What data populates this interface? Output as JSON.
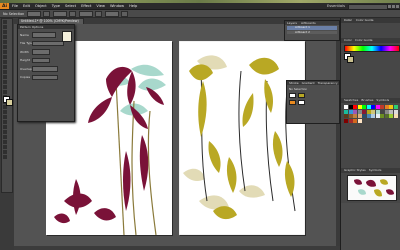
{
  "app": {
    "logo": "Ai",
    "menu": [
      "File",
      "Edit",
      "Object",
      "Type",
      "Select",
      "Effect",
      "View",
      "Window",
      "Help"
    ],
    "workspace": "Essentials",
    "icons": [
      "search-icon",
      "minimize-icon",
      "maximize-icon",
      "close-icon"
    ]
  },
  "control_bar": {
    "label": "No Selection"
  },
  "document": {
    "tab_title": "Untitled-1* @ 100% (CMYK/Preview)"
  },
  "float_panel": {
    "title": "Pattern Options",
    "rows": [
      "Name",
      "Tile Type",
      "Width",
      "Height",
      "Overlap",
      "Copies"
    ]
  },
  "layers_panel": {
    "tabs": [
      "Layers",
      "Artboards"
    ],
    "rows": [
      "Artboard 1",
      "Artboard 2"
    ]
  },
  "mid_panel": {
    "tabs": [
      "Stroke",
      "Gradient",
      "Transparency"
    ],
    "rows": [
      "No Selection",
      "",
      ""
    ]
  },
  "dock": {
    "top_tabs": [
      "Color",
      "Color Guide"
    ],
    "swatch_tabs": [
      "Swatches",
      "Brushes",
      "Symbols"
    ],
    "symbol_tabs": [
      "Graphic Styles",
      "Symbols"
    ],
    "accent": "#6a7fa6",
    "swatch_colors": [
      "#ffffff",
      "#000000",
      "#ff0000",
      "#ffff00",
      "#00ff00",
      "#00ffff",
      "#0000ff",
      "#ff00ff",
      "#c0392b",
      "#e67e22",
      "#f1c40f",
      "#2ecc71",
      "#1abc9c",
      "#3498db",
      "#9b59b6",
      "#7f8c8d",
      "#8b1a2f",
      "#b5a91a",
      "#cfc77b",
      "#a5d8cc",
      "#444444",
      "#888888",
      "#bbbbbb",
      "#dddddd",
      "#5b3a1a",
      "#8e5a2a",
      "#c08040",
      "#e0b080",
      "#2a4d69",
      "#4b86b4",
      "#adcbe3",
      "#e7eff6",
      "#6b8e23",
      "#556b2f",
      "#9acd32",
      "#f5deb3",
      "#800000",
      "#a52a2a",
      "#d2691e",
      "#ffe4c4"
    ]
  },
  "artwork": {
    "left_colors": [
      "#7a1238",
      "#a8d8cc",
      "#8a7a3a"
    ],
    "right_colors": [
      "#b9a824",
      "#e2dbb6",
      "#2b2b2b"
    ]
  }
}
